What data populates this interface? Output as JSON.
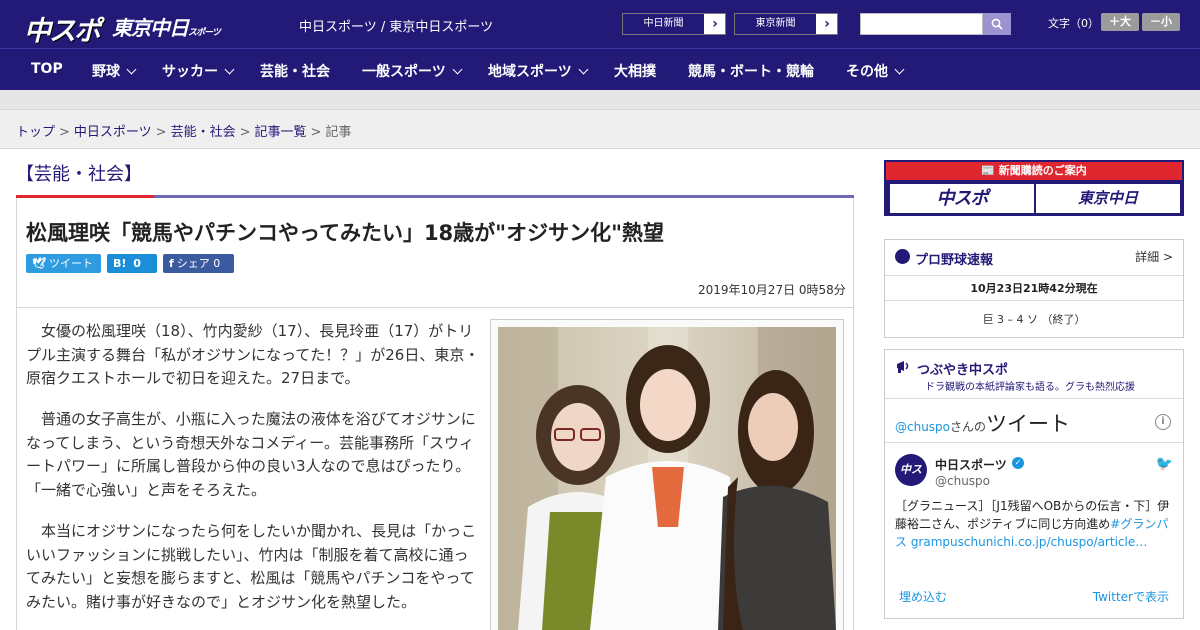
{
  "header": {
    "logo_chuspo": "中スポ",
    "logo_tokyo": "東京中日",
    "logo_tokyo_small": "スポーツ",
    "site_title": "中日スポーツ / 東京中日スポーツ",
    "ext_links": [
      {
        "label": "中日新聞",
        "arrow": "›"
      },
      {
        "label": "東京新聞",
        "arrow": "›"
      }
    ],
    "search_placeholder": "",
    "font_label": "文字（0）",
    "font_bigger": "＋大",
    "font_smaller": "－小"
  },
  "nav": {
    "items": [
      {
        "label": "TOP",
        "dropdown": false
      },
      {
        "label": "野球",
        "dropdown": true
      },
      {
        "label": "サッカー",
        "dropdown": true
      },
      {
        "label": "芸能・社会",
        "dropdown": false
      },
      {
        "label": "一般スポーツ",
        "dropdown": true
      },
      {
        "label": "地域スポーツ",
        "dropdown": true
      },
      {
        "label": "大相撲",
        "dropdown": false
      },
      {
        "label": "競馬・ボート・競輪",
        "dropdown": false
      },
      {
        "label": "その他",
        "dropdown": true
      }
    ]
  },
  "breadcrumb": {
    "items": [
      "トップ",
      "中日スポーツ",
      "芸能・社会",
      "記事一覧"
    ],
    "current": "記事",
    "separator": ">"
  },
  "article": {
    "category": "【芸能・社会】",
    "headline": "松風理咲「競馬やパチンコやってみたい」18歳が\"オジサン化\"熱望",
    "share_tweet": "ツイート",
    "share_hatena_icon": "B!",
    "share_hatena_count": "0",
    "share_fb_label": "シェア",
    "share_fb_count": "0",
    "date": "2019年10月27日 0時58分",
    "paragraphs": [
      "女優の松風理咲（18）、竹内愛紗（17）、長見玲亜（17）がトリプル主演する舞台「私がオジサンになってた！？」が26日、東京・原宿クエストホールで初日を迎えた。27日まで。",
      "普通の女子高生が、小瓶に入った魔法の液体を浴びてオジサンになってしまう、という奇想天外なコメディー。芸能事務所「スウィートパワー」に所属し普段から仲の良い3人なので息はぴったり。「一緒で心強い」と声をそろえた。",
      "本当にオジサンになったら何をしたいか聞かれ、長見は「かっこいいファッションに挑戦したい」、竹内は「制服を着て高校に通ってみたい」と妄想を膨らますと、松風は「競馬やパチンコをやってみたい。賭け事が好きなので」とオジサン化を熱望した。"
    ]
  },
  "sidebar": {
    "subscribe": {
      "header": "新聞購読のご案内",
      "btn1": "中スポ",
      "btn2": "東京中日"
    },
    "baseball": {
      "title": "プロ野球速報",
      "detail": "詳細 >",
      "time": "10月23日21時42分現在",
      "score": "巨 3 – 4 ソ （終了）"
    },
    "tweets": {
      "title": "つぶやき中スポ",
      "subtitle": "ドラ観戦の本紙評論家も語る。グラも熱烈応援",
      "handle": "@chuspo",
      "handle_suffix": "さんの",
      "tweet_word": "ツイート",
      "info_icon": "i",
      "avatar_text": "中スポ",
      "name": "中日スポーツ",
      "verified": "✓",
      "id": "@chuspo",
      "text_plain": "［グラニュース］［J1残留へOBからの伝言・下］伊藤裕二さん、ポジティブに同じ方向進め",
      "text_hash": "#グランパス grampuschunichi.co.jp/chuspo/article…",
      "embed": "埋め込む",
      "view_on": "Twitterで表示"
    }
  },
  "colors": {
    "brand_navy": "#231a78",
    "accent_red": "#e0262f",
    "twitter_blue": "#1b95e0"
  }
}
